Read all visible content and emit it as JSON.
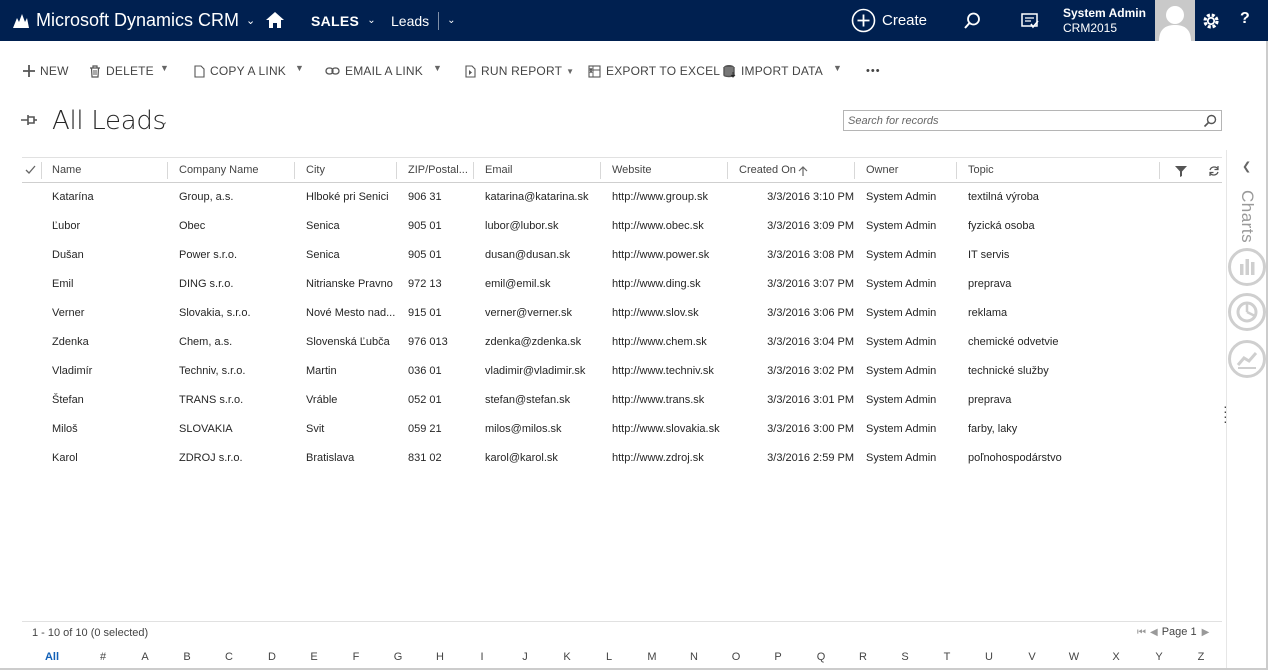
{
  "topbar": {
    "app_title": "Microsoft Dynamics CRM",
    "area": "SALES",
    "entity": "Leads",
    "create_label": "Create",
    "user_name": "System Admin",
    "org_name": "CRM2015",
    "help_label": "?"
  },
  "commands": {
    "new": "NEW",
    "delete": "DELETE",
    "copy_link": "COPY A LINK",
    "email_link": "EMAIL A LINK",
    "run_report": "RUN REPORT",
    "export_excel": "EXPORT TO EXCEL",
    "import_data": "IMPORT DATA",
    "more": "•••"
  },
  "view": {
    "title": "All Leads",
    "search_placeholder": "Search for records"
  },
  "columns": [
    "Name",
    "Company Name",
    "City",
    "ZIP/Postal...",
    "Email",
    "Website",
    "Created On",
    "Owner",
    "Topic"
  ],
  "sorted_column": "Created On",
  "rows": [
    {
      "name": "Katarína",
      "company": "Group, a.s.",
      "city": "Hlboké pri Senici",
      "zip": "906 31",
      "email": "katarina@katarina.sk",
      "website": "http://www.group.sk",
      "created": "3/3/2016 3:10 PM",
      "owner": "System Admin",
      "topic": "textilná výroba"
    },
    {
      "name": "Ľubor",
      "company": "Obec",
      "city": "Senica",
      "zip": "905 01",
      "email": "lubor@lubor.sk",
      "website": "http://www.obec.sk",
      "created": "3/3/2016 3:09 PM",
      "owner": "System Admin",
      "topic": "fyzická osoba"
    },
    {
      "name": "Dušan",
      "company": "Power s.r.o.",
      "city": "Senica",
      "zip": "905 01",
      "email": "dusan@dusan.sk",
      "website": "http://www.power.sk",
      "created": "3/3/2016 3:08 PM",
      "owner": "System Admin",
      "topic": "IT servis"
    },
    {
      "name": "Emil",
      "company": "DING s.r.o.",
      "city": "Nitrianske Pravno",
      "zip": "972 13",
      "email": "emil@emil.sk",
      "website": "http://www.ding.sk",
      "created": "3/3/2016 3:07 PM",
      "owner": "System Admin",
      "topic": "preprava"
    },
    {
      "name": "Verner",
      "company": "Slovakia, s.r.o.",
      "city": "Nové Mesto nad...",
      "zip": "915 01",
      "email": "verner@verner.sk",
      "website": "http://www.slov.sk",
      "created": "3/3/2016 3:06 PM",
      "owner": "System Admin",
      "topic": "reklama"
    },
    {
      "name": "Zdenka",
      "company": "Chem, a.s.",
      "city": "Slovenská Ľubča",
      "zip": "976 013",
      "email": "zdenka@zdenka.sk",
      "website": "http://www.chem.sk",
      "created": "3/3/2016 3:04 PM",
      "owner": "System Admin",
      "topic": "chemické odvetvie"
    },
    {
      "name": "Vladimír",
      "company": "Techniv, s.r.o.",
      "city": "Martin",
      "zip": "036 01",
      "email": "vladimir@vladimir.sk",
      "website": "http://www.techniv.sk",
      "created": "3/3/2016 3:02 PM",
      "owner": "System Admin",
      "topic": "technické služby"
    },
    {
      "name": "Štefan",
      "company": "TRANS s.r.o.",
      "city": "Vráble",
      "zip": "052 01",
      "email": "stefan@stefan.sk",
      "website": "http://www.trans.sk",
      "created": "3/3/2016 3:01 PM",
      "owner": "System Admin",
      "topic": "preprava"
    },
    {
      "name": "Miloš",
      "company": "SLOVAKIA",
      "city": "Svit",
      "zip": "059 21",
      "email": "milos@milos.sk",
      "website": "http://www.slovakia.sk",
      "created": "3/3/2016 3:00 PM",
      "owner": "System Admin",
      "topic": "farby, laky"
    },
    {
      "name": "Karol",
      "company": "ZDROJ s.r.o.",
      "city": "Bratislava",
      "zip": "831 02",
      "email": "karol@karol.sk",
      "website": "http://www.zdroj.sk",
      "created": "3/3/2016 2:59 PM",
      "owner": "System Admin",
      "topic": "poľnohospodárstvo"
    }
  ],
  "footer": {
    "status": "1 - 10 of 10 (0 selected)",
    "page_label": "Page 1"
  },
  "alphabet": [
    "All",
    "#",
    "A",
    "B",
    "C",
    "D",
    "E",
    "F",
    "G",
    "H",
    "I",
    "J",
    "K",
    "L",
    "M",
    "N",
    "O",
    "P",
    "Q",
    "R",
    "S",
    "T",
    "U",
    "V",
    "W",
    "X",
    "Y",
    "Z"
  ],
  "active_letter": "All",
  "side_panel": {
    "label": "Charts"
  },
  "colors": {
    "nav_bar": "#002050",
    "accent": "#1160b7",
    "text": "#262626",
    "muted": "#444444"
  }
}
